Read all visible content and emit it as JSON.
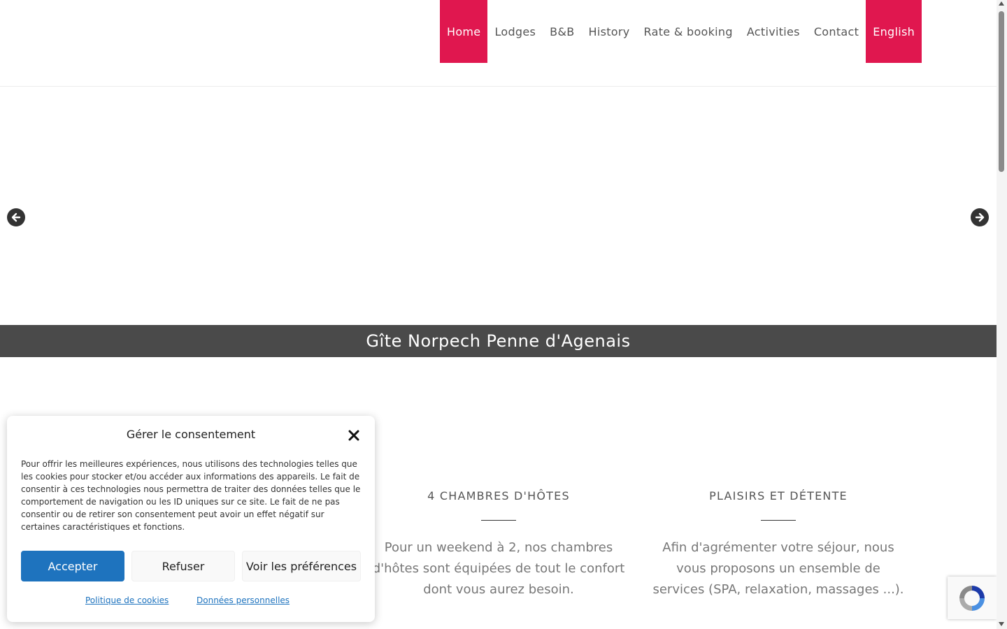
{
  "colors": {
    "accent": "#e0174f",
    "caption_bg": "#4a4a4a",
    "button_primary": "#1e73be"
  },
  "nav": {
    "items": [
      {
        "label": "Home",
        "active": true
      },
      {
        "label": "Lodges"
      },
      {
        "label": "B&B"
      },
      {
        "label": "History"
      },
      {
        "label": "Rate & booking"
      },
      {
        "label": "Activities"
      },
      {
        "label": "Contact"
      }
    ],
    "language": "English"
  },
  "slider": {
    "prev_icon": "arrow-left-circle-icon",
    "next_icon": "arrow-right-circle-icon",
    "caption": "Gîte Norpech Penne d'Agenais"
  },
  "features": [
    {
      "title": "4 CHAMBRES D'HÔTES",
      "text_lines": [
        "Pour un weekend à 2, nos chambres",
        "d'hôtes sont équipées de tout le confort",
        "dont vous aurez besoin."
      ]
    },
    {
      "title": "PLAISIRS ET DÉTENTE",
      "text_lines": [
        "Afin d'agrémenter votre séjour, nous",
        "vous proposons un ensemble de",
        "services (SPA, relaxation, massages ...)."
      ]
    }
  ],
  "consent": {
    "title": "Gérer le consentement",
    "close_icon": "close-icon",
    "text": "Pour offrir les meilleures expériences, nous utilisons des technologies telles que les cookies pour stocker et/ou accéder aux informations des appareils. Le fait de consentir à ces technologies nous permettra de traiter des données telles que le comportement de navigation ou les ID uniques sur ce site. Le fait de ne pas consentir ou de retirer son consentement peut avoir un effet négatif sur certaines caractéristiques et fonctions.",
    "accept": "Accepter",
    "refuse": "Refuser",
    "preferences": "Voir les préférences",
    "link_cookies": "Politique de cookies",
    "link_data": "Données personnelles"
  }
}
